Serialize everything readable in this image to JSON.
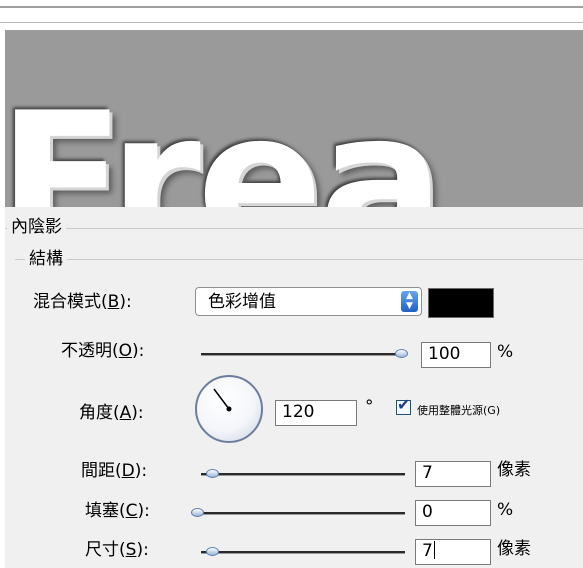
{
  "preview": {
    "text": "Frea"
  },
  "panel": {
    "section_title": "內陰影",
    "group_title": "結構",
    "blend_mode": {
      "label": "混合模式",
      "key": "B",
      "value": "色彩增值",
      "color": "#000000"
    },
    "opacity": {
      "label": "不透明",
      "key": "O",
      "value": "100",
      "unit": "%"
    },
    "angle": {
      "label": "角度",
      "key": "A",
      "value": "120",
      "unit": "°",
      "global_light_label": "使用整體光源(G)",
      "global_light_checked": true
    },
    "distance": {
      "label": "間距",
      "key": "D",
      "value": "7",
      "unit": "像素"
    },
    "choke": {
      "label": "填塞",
      "key": "C",
      "value": "0",
      "unit": "%"
    },
    "size": {
      "label": "尺寸",
      "key": "S",
      "value": "7",
      "unit": "像素"
    }
  },
  "colors": {
    "accent": "#2e6fd0",
    "swatch": "#000000",
    "preview_bg": "#9a9a9a"
  }
}
